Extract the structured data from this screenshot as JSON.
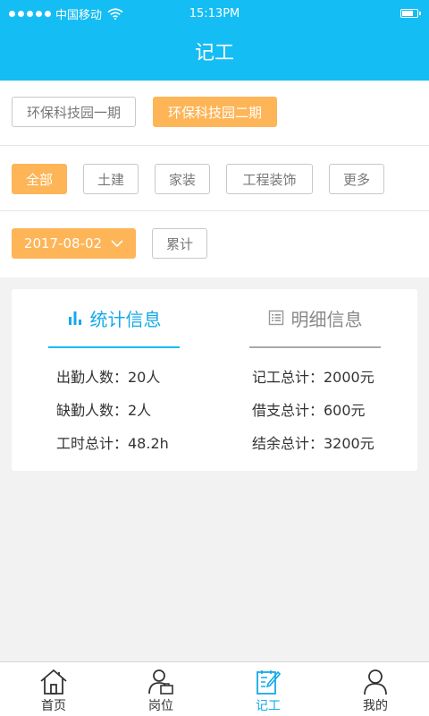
{
  "status_bar": {
    "carrier": "中国移动",
    "time": "15:13PM"
  },
  "header": {
    "title": "记工"
  },
  "filters": {
    "parks": [
      {
        "label": "环保科技园一期",
        "selected": false
      },
      {
        "label": "环保科技园二期",
        "selected": true
      }
    ],
    "categories": [
      {
        "label": "全部",
        "selected": true
      },
      {
        "label": "土建",
        "selected": false
      },
      {
        "label": "家装",
        "selected": false
      },
      {
        "label": "工程装饰",
        "selected": false
      },
      {
        "label": "更多",
        "selected": false
      }
    ],
    "date": "2017-08-02",
    "cumulative_label": "累计"
  },
  "stats_card": {
    "tabs": [
      {
        "label": "统计信息",
        "icon": "bar-chart-icon",
        "active": true
      },
      {
        "label": "明细信息",
        "icon": "list-icon",
        "active": false
      }
    ],
    "left": [
      "出勤人数：20人",
      "缺勤人数：2人",
      "工时总计：48.2h"
    ],
    "right": [
      "记工总计：2000元",
      "借支总计：600元",
      "结余总计：3200元"
    ]
  },
  "tab_bar": [
    {
      "label": "首页",
      "icon": "home-icon",
      "active": false
    },
    {
      "label": "岗位",
      "icon": "job-icon",
      "active": false
    },
    {
      "label": "记工",
      "icon": "record-icon",
      "active": true
    },
    {
      "label": "我的",
      "icon": "profile-icon",
      "active": false
    }
  ],
  "colors": {
    "primary": "#14bdf3",
    "accent": "#fdb558"
  }
}
